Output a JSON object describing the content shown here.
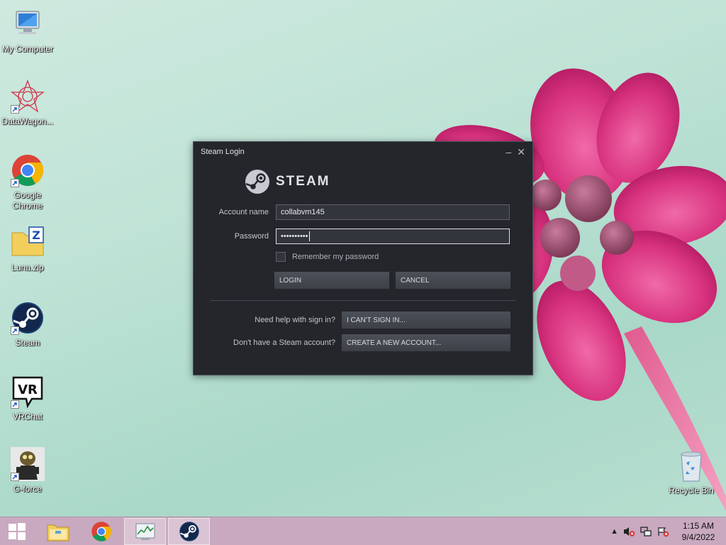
{
  "desktop": {
    "icons": [
      {
        "label": "My Computer"
      },
      {
        "label": "DataWagon..."
      },
      {
        "label": "Google Chrome"
      },
      {
        "label": "Luna.zip"
      },
      {
        "label": "Steam"
      },
      {
        "label": "VRChat"
      },
      {
        "label": "G-force"
      },
      {
        "label": "Recycle Bin"
      }
    ]
  },
  "steam_login": {
    "title": "Steam Login",
    "logo_text": "STEAM",
    "account_label": "Account name",
    "account_value": "collabvm145",
    "password_label": "Password",
    "password_value": "••••••••••",
    "remember_label": "Remember my password",
    "remember_checked": false,
    "login_button": "LOGIN",
    "cancel_button": "CANCEL",
    "help_label": "Need help with sign in?",
    "cant_sign_in_button": "I CAN'T SIGN IN...",
    "no_account_label": "Don't have a Steam account?",
    "create_account_button": "CREATE A NEW ACCOUNT..."
  },
  "taskbar": {
    "time": "1:15 AM",
    "date": "9/4/2022",
    "pinned": [
      "windows-start-icon",
      "file-explorer-icon",
      "chrome-icon",
      "task-manager-icon",
      "steam-icon"
    ]
  },
  "colors": {
    "steam_bg": "#24262b",
    "taskbar": "#c9a9bf",
    "flower": "#e0428e"
  }
}
